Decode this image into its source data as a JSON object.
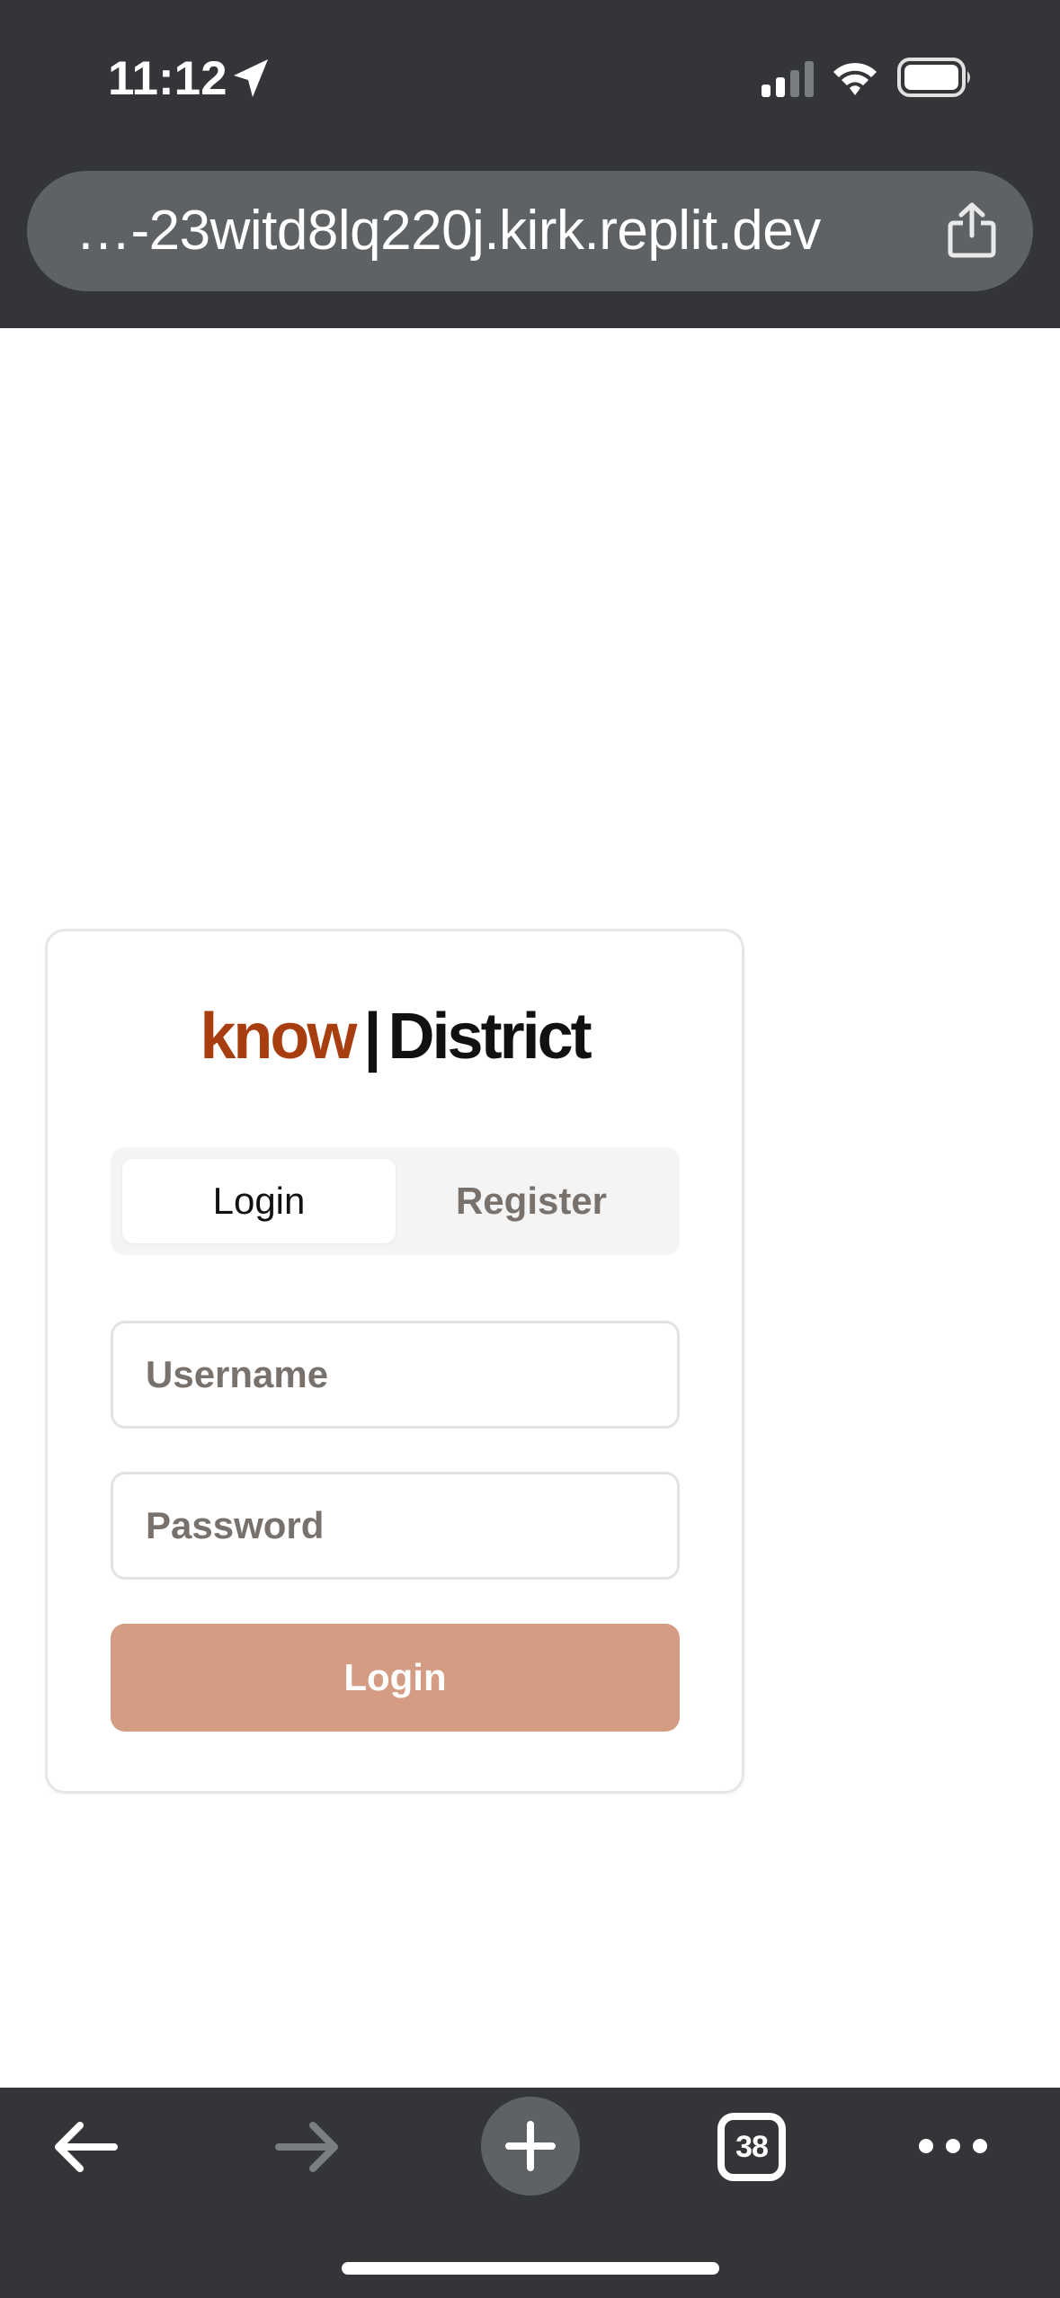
{
  "status_bar": {
    "time": "11:12"
  },
  "browser": {
    "url": "…-23witd8lq220j.kirk.replit.dev",
    "tab_count": "38"
  },
  "brand": {
    "accent": "know",
    "separator": "|",
    "main": "District",
    "accent_color": "#a83e10"
  },
  "auth_tabs": {
    "login_label": "Login",
    "register_label": "Register",
    "selected": "Login"
  },
  "form": {
    "username_placeholder": "Username",
    "username_value": "",
    "password_placeholder": "Password",
    "password_value": "",
    "submit_label": "Login",
    "submit_color": "#d49c83"
  },
  "icons": {
    "location": "location-arrow-icon",
    "signal": "cellular-signal-icon",
    "wifi": "wifi-icon",
    "battery": "battery-icon",
    "share": "share-icon",
    "back": "arrow-left-icon",
    "forward": "arrow-right-icon",
    "new_tab": "plus-icon",
    "more": "more-dots-icon"
  }
}
